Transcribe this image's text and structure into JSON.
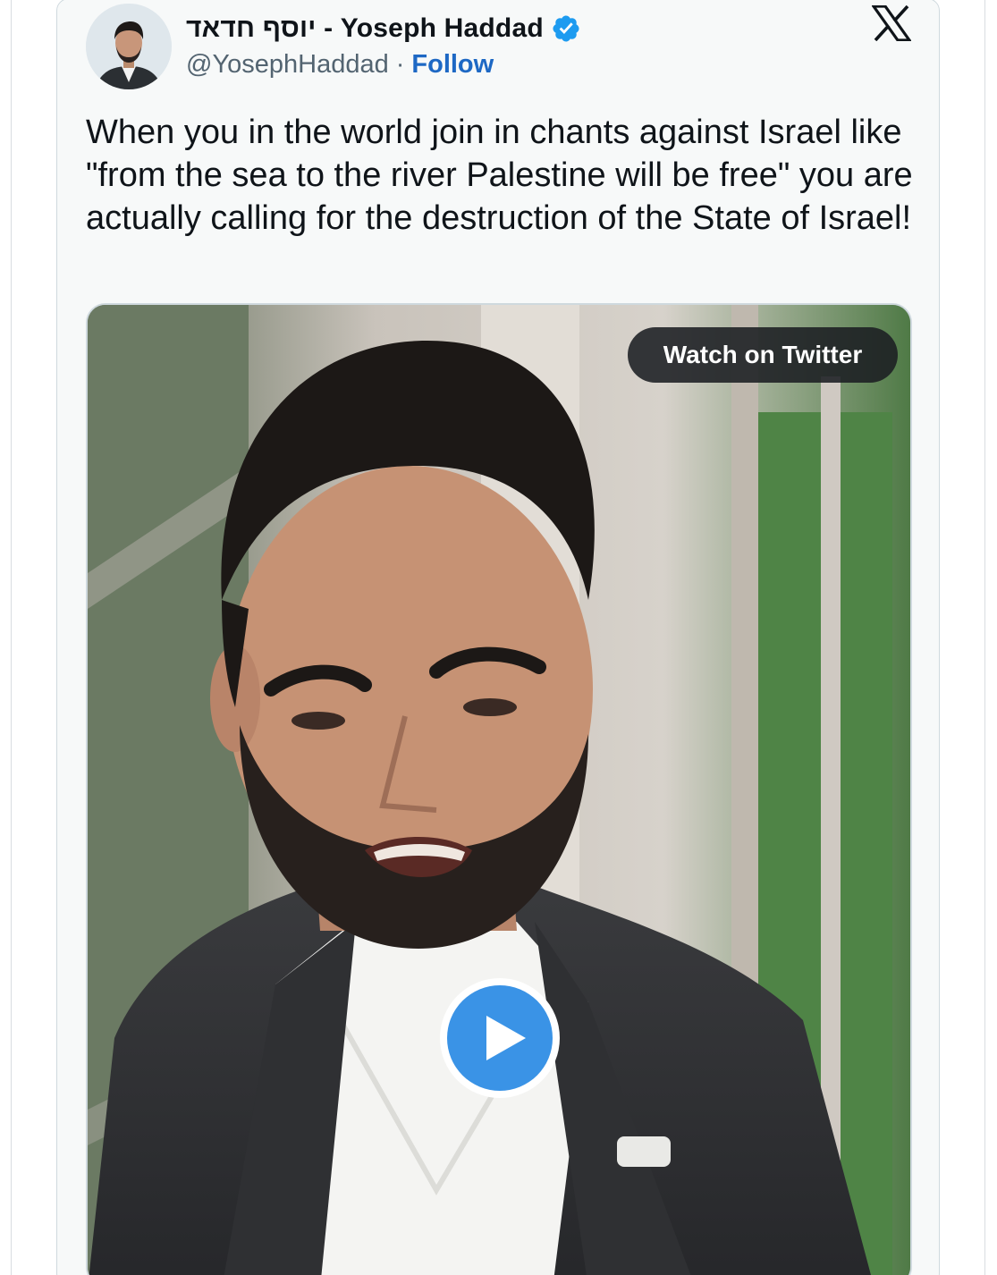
{
  "tweet": {
    "author_name": "יוסף חדאד - Yoseph Haddad",
    "handle": "@YosephHaddad",
    "separator": "·",
    "follow_label": "Follow",
    "text": "When you in the world join in chants against Israel like \"from the sea to the river Palestine will be free\" you are actually calling for the destruction of the State of Israel!",
    "verified": true
  },
  "media": {
    "watch_label": "Watch on Twitter",
    "type": "video"
  },
  "icons": {
    "brand": "x-logo-icon",
    "verified": "verified-badge-icon",
    "play": "play-icon"
  },
  "colors": {
    "follow_link": "#1d68c4",
    "verified_badge": "#1d9bf0",
    "play_button": "#3a93e6",
    "text": "#0f1419",
    "secondary_text": "#536471",
    "card_background": "#f7f9f9"
  }
}
